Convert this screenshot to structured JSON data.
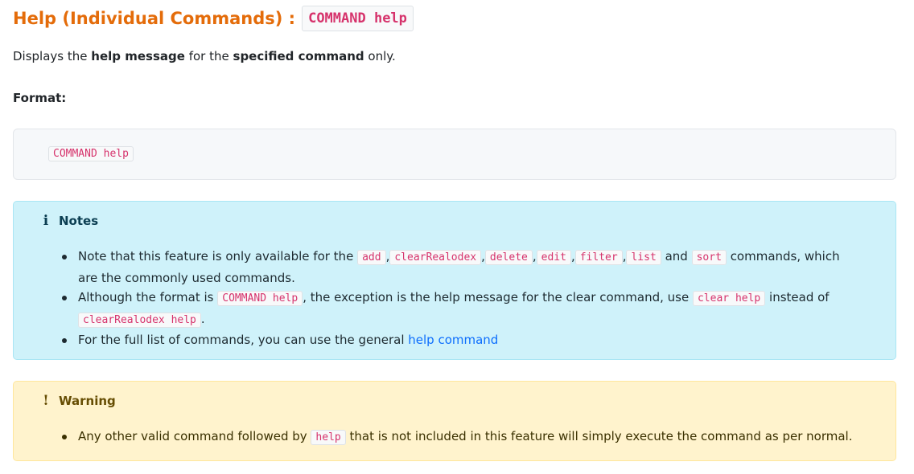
{
  "heading": {
    "title": "Help (Individual Commands) :",
    "code": "COMMAND help"
  },
  "description": {
    "prefix": "Displays the",
    "bold1": "help message",
    "middle": "for the",
    "bold2": "specified command",
    "suffix": "only."
  },
  "format": {
    "label": "Format:",
    "code": "COMMAND help"
  },
  "notes": {
    "title": "Notes",
    "icon": "info-icon",
    "item1": {
      "text_a": "Note that this feature is only available for the",
      "codes": [
        "add",
        "clearRealodex",
        "delete",
        "edit",
        "filter",
        "list",
        "sort"
      ],
      "sep": ",",
      "and": "and",
      "text_b": "commands, which are the commonly used commands."
    },
    "item2": {
      "text_a": "Although the format is",
      "code_a": "COMMAND help",
      "text_b": ", the exception is the help message for the clear command, use",
      "code_b": "clear help",
      "text_c": "instead of",
      "code_c": "clearRealodex help",
      "text_d": "."
    },
    "item3": {
      "text_a": "For the full list of commands, you can use the general",
      "link": "help command"
    }
  },
  "warning": {
    "title": "Warning",
    "icon": "exclamation-icon",
    "item1": {
      "text_a": "Any other valid command followed by",
      "code": "help",
      "text_b": "that is not included in this feature will simply execute the command as per normal."
    }
  },
  "colors": {
    "heading": "#e46c0a",
    "code_text": "#d6336c",
    "info_bg": "#cff2fa",
    "warning_bg": "#fff3cd",
    "link": "#0d6efd"
  }
}
